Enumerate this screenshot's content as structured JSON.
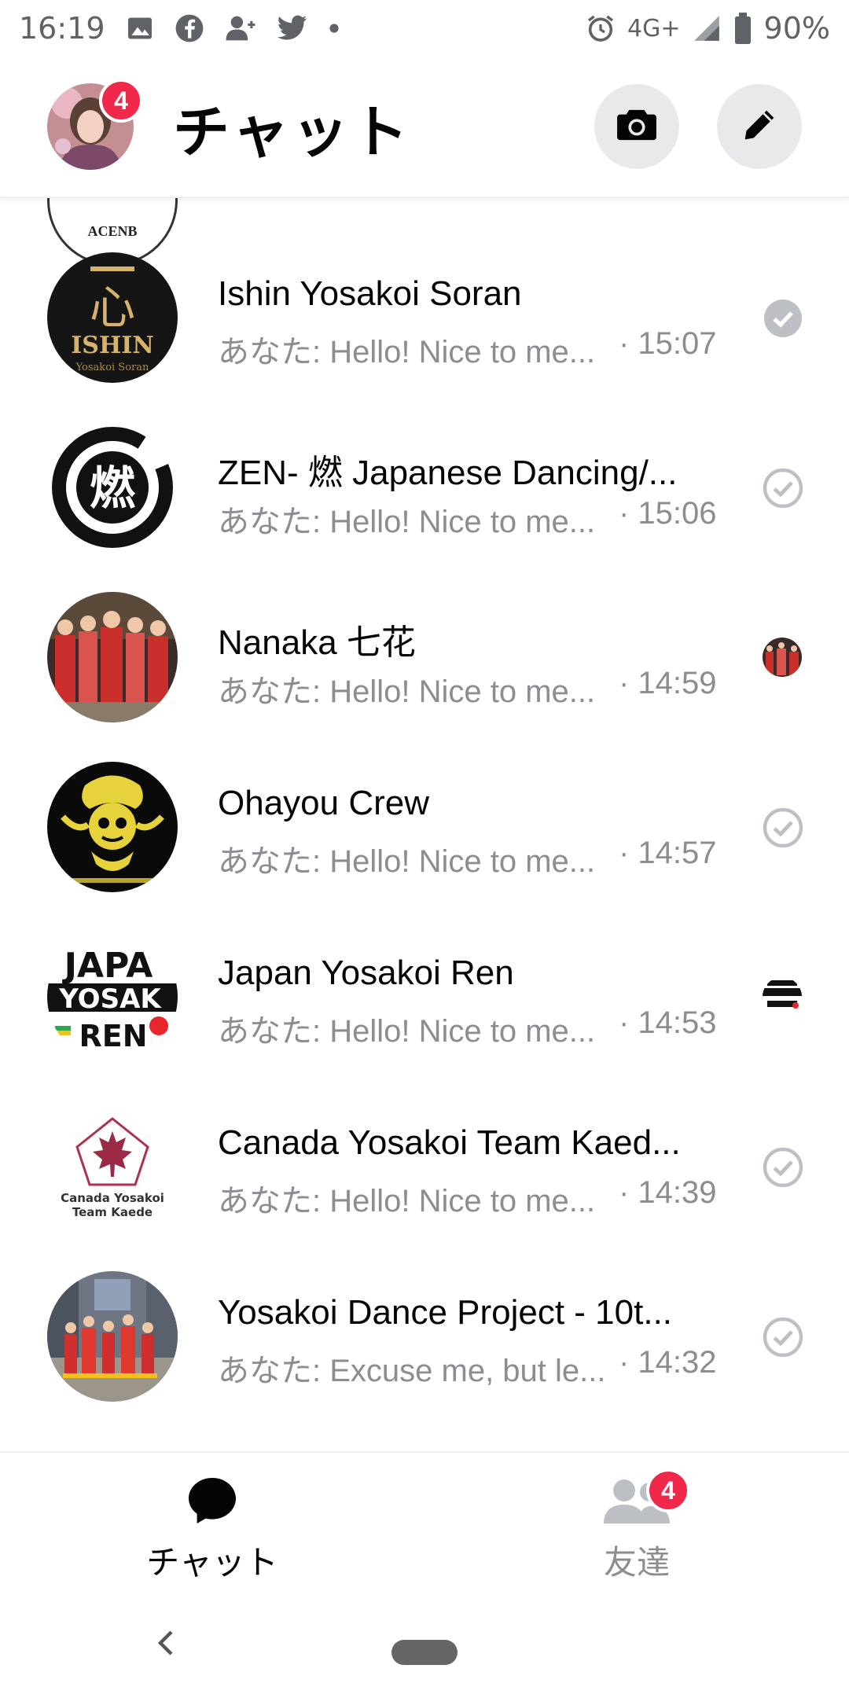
{
  "status_bar": {
    "time": "16:19",
    "network": "4G+",
    "battery": "90%",
    "icons": [
      "image-icon",
      "facebook-icon",
      "add-person-icon",
      "twitter-icon",
      "dot-icon",
      "alarm-icon",
      "signal-icon",
      "battery-icon"
    ]
  },
  "header": {
    "title": "チャット",
    "profile_badge": "4",
    "camera_icon": "camera-icon",
    "compose_icon": "pencil-icon"
  },
  "partial_row": {
    "avatar_text": "ACENB"
  },
  "chats": [
    {
      "name": "Ishin Yosakoi Soran",
      "preview": "あなた: Hello! Nice to me...",
      "time": "· 15:07",
      "status": "sent-check",
      "avatar": "ishin"
    },
    {
      "name": "ZEN- 燃 Japanese Dancing/...",
      "preview": "あなた: Hello! Nice to me...",
      "time": "· 15:06",
      "status": "sent-check",
      "avatar": "zen"
    },
    {
      "name": "Nanaka 七花",
      "preview": "あなた: Hello! Nice to me...",
      "time": "· 14:59",
      "status": "seen-avatar",
      "avatar": "nanaka"
    },
    {
      "name": "Ohayou Crew",
      "preview": "あなた: Hello! Nice to me...",
      "time": "· 14:57",
      "status": "sent-check",
      "avatar": "ohayou"
    },
    {
      "name": "Japan Yosakoi Ren",
      "preview": "あなた: Hello! Nice to me...",
      "time": "· 14:53",
      "status": "seen-avatar",
      "avatar": "japan"
    },
    {
      "name": "Canada Yosakoi Team Kaed...",
      "preview": "あなた: Hello! Nice to me...",
      "time": "· 14:39",
      "status": "sent-check",
      "avatar": "canada"
    },
    {
      "name": "Yosakoi Dance Project - 10t...",
      "preview": "あなた: Excuse me, but le...",
      "time": "· 14:32",
      "status": "sent-check",
      "avatar": "project"
    }
  ],
  "avatar_text": {
    "ishin_glyph": "心",
    "ishin_word": "ISHIN",
    "ishin_sub": "Yosakoi Soran",
    "zen_glyph": "燃",
    "canada_line1": "Canada Yosakoi",
    "canada_line2": "Team Kaede",
    "japan_lines": [
      "JAPA",
      "YOSAK",
      "REN"
    ]
  },
  "bottom_nav": {
    "chats_label": "チャット",
    "friends_label": "友達",
    "friends_badge": "4"
  },
  "colors": {
    "badge": "#f02849",
    "secondary_text": "#8a8d91",
    "button_bg": "#e9e9eb"
  }
}
